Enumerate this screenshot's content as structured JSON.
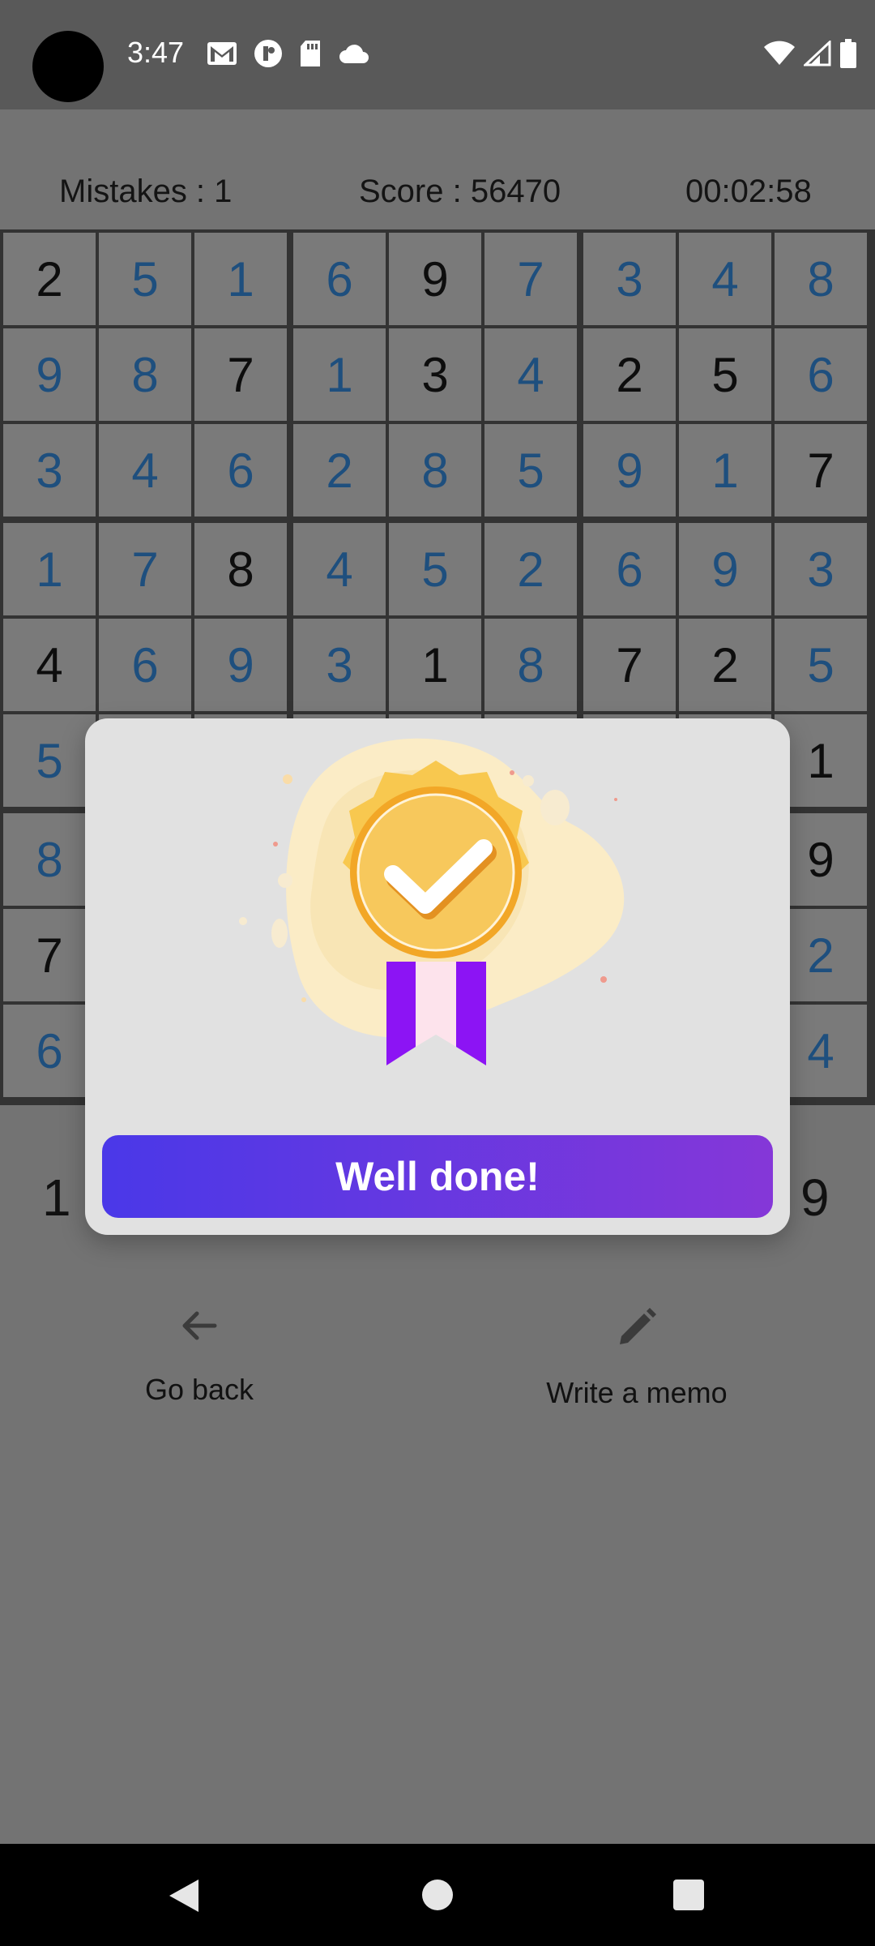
{
  "status_bar": {
    "time": "3:47",
    "left_icons": [
      "gmail-icon",
      "cat-icon",
      "sd-card-icon",
      "cloud-icon"
    ],
    "right_icons": [
      "wifi-icon",
      "signal-icon",
      "battery-icon"
    ]
  },
  "stats": {
    "mistakes": "Mistakes : 1",
    "score": "Score : 56470",
    "timer": "00:02:58"
  },
  "board": {
    "values": [
      [
        2,
        5,
        1,
        6,
        9,
        7,
        3,
        4,
        8
      ],
      [
        9,
        8,
        7,
        1,
        3,
        4,
        2,
        5,
        6
      ],
      [
        3,
        4,
        6,
        2,
        8,
        5,
        9,
        1,
        7
      ],
      [
        1,
        7,
        8,
        4,
        5,
        2,
        6,
        9,
        3
      ],
      [
        4,
        6,
        9,
        3,
        1,
        8,
        7,
        2,
        5
      ],
      [
        5,
        null,
        null,
        null,
        null,
        null,
        null,
        null,
        1
      ],
      [
        8,
        null,
        null,
        null,
        null,
        null,
        null,
        null,
        9
      ],
      [
        7,
        null,
        null,
        null,
        null,
        null,
        null,
        null,
        2
      ],
      [
        6,
        null,
        null,
        null,
        null,
        null,
        null,
        null,
        4
      ]
    ],
    "given": [
      [
        1,
        0,
        0,
        0,
        1,
        0,
        0,
        0,
        0
      ],
      [
        0,
        0,
        1,
        0,
        1,
        0,
        1,
        1,
        0
      ],
      [
        0,
        0,
        0,
        0,
        0,
        0,
        0,
        0,
        1
      ],
      [
        0,
        0,
        1,
        0,
        0,
        0,
        0,
        0,
        0
      ],
      [
        1,
        0,
        0,
        0,
        1,
        0,
        1,
        1,
        0
      ],
      [
        0,
        0,
        0,
        0,
        0,
        0,
        0,
        0,
        1
      ],
      [
        0,
        0,
        0,
        0,
        0,
        0,
        0,
        0,
        1
      ],
      [
        1,
        0,
        0,
        0,
        0,
        0,
        0,
        0,
        0
      ],
      [
        0,
        0,
        0,
        0,
        0,
        0,
        0,
        0,
        0
      ]
    ]
  },
  "numpad": {
    "first": "1",
    "last": "9"
  },
  "actions": {
    "back_label": "Go back",
    "memo_label": "Write a memo"
  },
  "dialog": {
    "button_label": "Well done!",
    "badge_icon": "award-badge-checkmark-icon"
  },
  "colors": {
    "given_digit": "#0d0d0d",
    "filled_digit": "#1e4f7e",
    "button_gradient_start": "#4a38e8",
    "button_gradient_end": "#8537d8"
  }
}
